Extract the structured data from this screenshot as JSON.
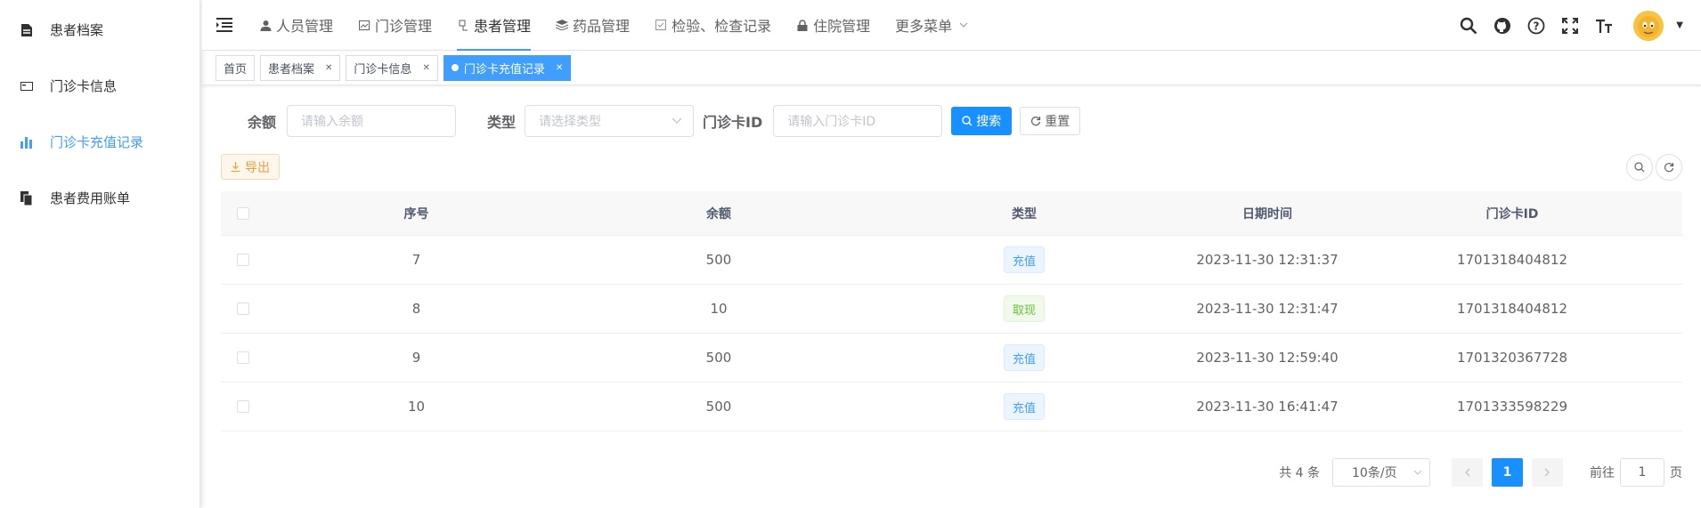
{
  "sidebar": {
    "items": [
      {
        "label": "患者档案",
        "icon": "document-icon"
      },
      {
        "label": "门诊卡信息",
        "icon": "card-icon"
      },
      {
        "label": "门诊卡充值记录",
        "icon": "bar-chart-icon",
        "active": true
      },
      {
        "label": "患者费用账单",
        "icon": "bill-icon"
      }
    ]
  },
  "topmenu": {
    "items": [
      {
        "label": "人员管理",
        "icon": "user-icon"
      },
      {
        "label": "门诊管理",
        "icon": "clinic-icon"
      },
      {
        "label": "患者管理",
        "icon": "patient-icon",
        "active": true
      },
      {
        "label": "药品管理",
        "icon": "medicine-icon"
      },
      {
        "label": "检验、检查记录",
        "icon": "checkbox-icon"
      },
      {
        "label": "住院管理",
        "icon": "lock-icon"
      },
      {
        "label": "更多菜单",
        "icon": "chevron-down-icon"
      }
    ]
  },
  "tags": [
    {
      "label": "首页"
    },
    {
      "label": "患者档案"
    },
    {
      "label": "门诊卡信息"
    },
    {
      "label": "门诊卡充值记录",
      "active": true
    }
  ],
  "search": {
    "balance_label": "余额",
    "balance_placeholder": "请输入余额",
    "type_label": "类型",
    "type_placeholder": "请选择类型",
    "card_label": "门诊卡ID",
    "card_placeholder": "请输入门诊卡ID",
    "search_btn": "搜索",
    "reset_btn": "重置"
  },
  "toolbar": {
    "export_btn": "导出"
  },
  "table": {
    "headers": [
      "序号",
      "余额",
      "类型",
      "日期时间",
      "门诊卡ID"
    ],
    "rows": [
      {
        "id": "7",
        "balance": "500",
        "type": "充值",
        "type_style": "blue",
        "datetime": "2023-11-30 12:31:37",
        "card": "1701318404812"
      },
      {
        "id": "8",
        "balance": "10",
        "type": "取现",
        "type_style": "green",
        "datetime": "2023-11-30 12:31:47",
        "card": "1701318404812"
      },
      {
        "id": "9",
        "balance": "500",
        "type": "充值",
        "type_style": "blue",
        "datetime": "2023-11-30 12:59:40",
        "card": "1701320367728"
      },
      {
        "id": "10",
        "balance": "500",
        "type": "充值",
        "type_style": "blue",
        "datetime": "2023-11-30 16:41:47",
        "card": "1701333598229"
      }
    ]
  },
  "pager": {
    "total": "共 4 条",
    "page_size": "10条/页",
    "current": "1",
    "goto_label": "前往",
    "goto_value": "1",
    "page_suffix": "页"
  },
  "colors": {
    "primary": "#1890ff",
    "success": "#67c23a",
    "warning": "#e6a23c"
  }
}
